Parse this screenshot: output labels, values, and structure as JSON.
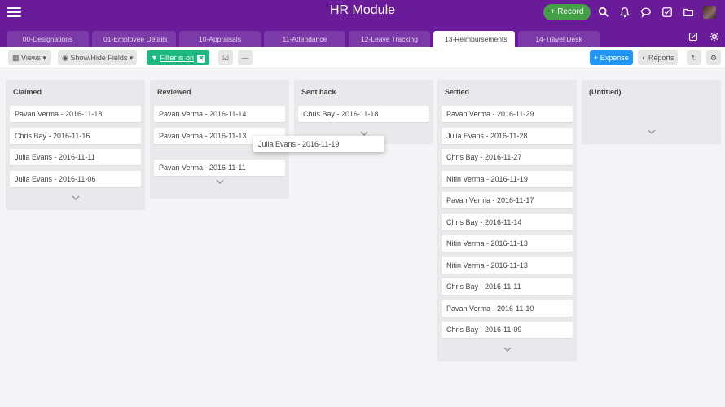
{
  "header": {
    "title": "HR Module",
    "record_label": "Record",
    "icons": [
      "search-icon",
      "bell-icon",
      "chat-icon",
      "checkbox-icon",
      "folder-icon"
    ]
  },
  "tabs": [
    {
      "label": "00-Designations",
      "active": false
    },
    {
      "label": "01-Employee Details",
      "active": false
    },
    {
      "label": "10-Appraisals",
      "active": false
    },
    {
      "label": "11-Attendance",
      "active": false
    },
    {
      "label": "12-Leave Tracking",
      "active": false
    },
    {
      "label": "13-Reimbursements",
      "active": true
    },
    {
      "label": "14-Travel Desk",
      "active": false
    }
  ],
  "toolbar": {
    "views_label": "Views",
    "fields_label": "Show/Hide Fields",
    "filter_label": "Filter is on",
    "expense_label": "Expense",
    "reports_label": "Reports"
  },
  "columns": [
    {
      "title": "Claimed",
      "cards": [
        "Pavan Verma - 2016-11-18",
        "Chris Bay - 2016-11-16",
        "Julia Evans - 2016-11-11",
        "Julia Evans - 2016-11-06"
      ]
    },
    {
      "title": "Reviewed",
      "cards": [
        "Pavan Verma - 2016-11-14",
        "Pavan Verma - 2016-11-13",
        "Pavan Verma - 2016-11-11"
      ]
    },
    {
      "title": "Sent back",
      "cards": [
        "Chris Bay - 2016-11-18"
      ]
    },
    {
      "title": "Settled",
      "cards": [
        "Pavan Verma - 2016-11-29",
        "Julia Evans - 2016-11-28",
        "Chris Bay - 2016-11-27",
        "Nitin Verma - 2016-11-19",
        "Pavan Verma - 2016-11-17",
        "Chris Bay - 2016-11-14",
        "Nitin Verma - 2016-11-13",
        "Nitin Verma - 2016-11-13",
        "Chris Bay - 2016-11-11",
        "Pavan Verma - 2016-11-10",
        "Chris Bay - 2016-11-09"
      ]
    },
    {
      "title": "(Untitled)",
      "cards": []
    }
  ],
  "dragging_card": "Julia Evans - 2016-11-19"
}
